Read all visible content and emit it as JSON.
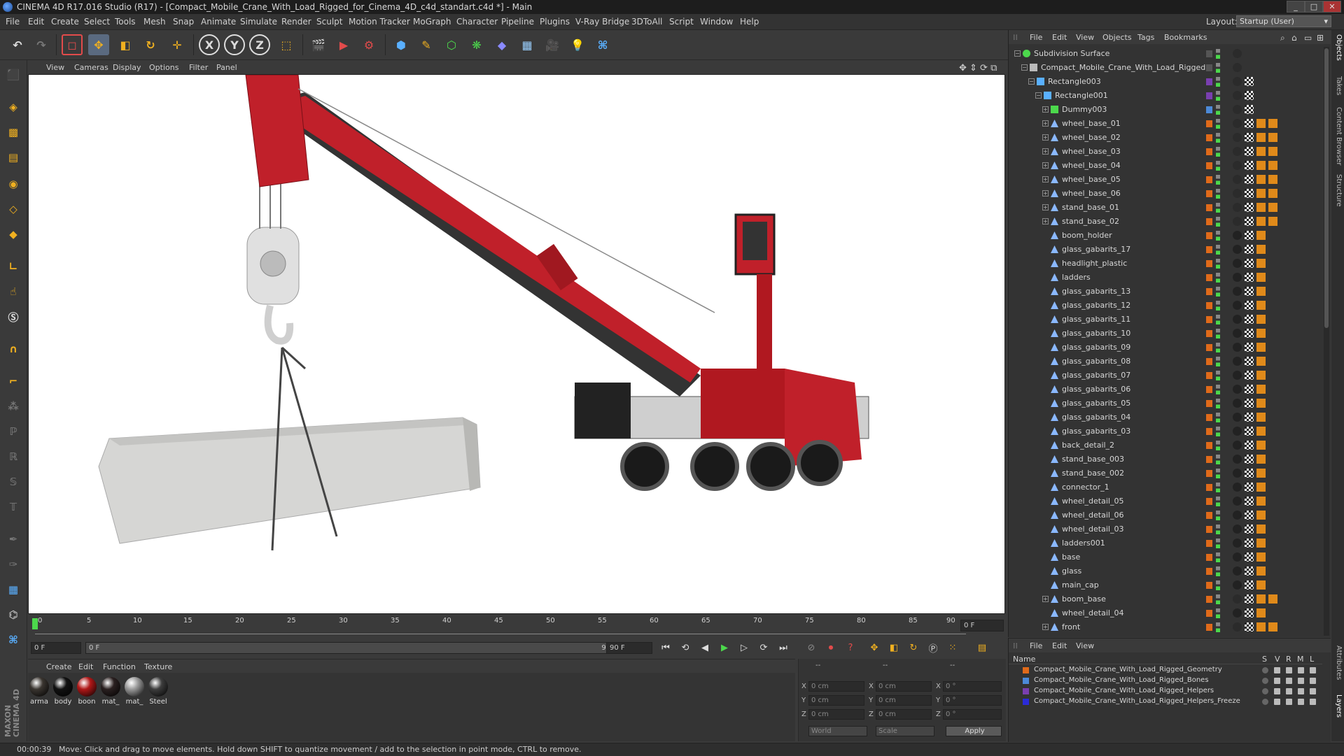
{
  "window": {
    "title": "CINEMA 4D R17.016 Studio (R17) - [Compact_Mobile_Crane_With_Load_Rigged_for_Cinema_4D_c4d_standart.c4d *] - Main",
    "buttons": [
      "_",
      "□",
      "✕"
    ]
  },
  "menubar": {
    "items": [
      "File",
      "Edit",
      "Create",
      "Select",
      "Tools",
      "Mesh",
      "Snap",
      "Animate",
      "Simulate",
      "Render",
      "Sculpt",
      "Motion Tracker",
      "MoGraph",
      "Character",
      "Pipeline",
      "Plugins",
      "V-Ray Bridge",
      "3DToAll",
      "Script",
      "Window",
      "Help"
    ],
    "layout_label": "Layout:",
    "layout_value": "Startup (User)"
  },
  "toolbar": {
    "axis_x": "X",
    "axis_y": "Y",
    "axis_z": "Z"
  },
  "viewport": {
    "menu": [
      "View",
      "Cameras",
      "Display",
      "Options",
      "Filter",
      "Panel"
    ]
  },
  "timeline": {
    "ticks": [
      "0",
      "5",
      "10",
      "15",
      "20",
      "25",
      "30",
      "35",
      "40",
      "45",
      "50",
      "55",
      "60",
      "65",
      "70",
      "75",
      "80",
      "85",
      "90"
    ],
    "current_frame_field": "0 F",
    "start_field": "0 F",
    "range_start": "0 F",
    "range_end": "90 F",
    "end_field": "90 F"
  },
  "material_manager": {
    "menu": [
      "Create",
      "Edit",
      "Function",
      "Texture"
    ],
    "materials": [
      {
        "name": "arma",
        "color": "#3a3530"
      },
      {
        "name": "body",
        "color": "#111111"
      },
      {
        "name": "boon",
        "color": "#b01818"
      },
      {
        "name": "mat_",
        "color": "#2a2020"
      },
      {
        "name": "mat_",
        "color": "#9a9a9a"
      },
      {
        "name": "Steel",
        "color": "#3d3d3d"
      }
    ]
  },
  "coordinates": {
    "headers": [
      "--",
      "--",
      "--"
    ],
    "rows": [
      {
        "axis": "X",
        "pos": "0 cm",
        "size": "0 cm",
        "rot_label": "X",
        "rot": "0 °"
      },
      {
        "axis": "Y",
        "pos": "0 cm",
        "size": "0 cm",
        "rot_label": "Y",
        "rot": "0 °"
      },
      {
        "axis": "Z",
        "pos": "0 cm",
        "size": "0 cm",
        "rot_label": "Z",
        "rot": "0 °"
      }
    ],
    "size_labels": [
      "X",
      "Y",
      "Z"
    ],
    "world": "World",
    "scale": "Scale",
    "apply": "Apply"
  },
  "status": {
    "time": "00:00:39",
    "message": "Move: Click and drag to move elements. Hold down SHIFT to quantize movement / add to the selection in point mode, CTRL to remove."
  },
  "object_manager": {
    "menu": [
      "File",
      "Edit",
      "View",
      "Objects",
      "Tags",
      "Bookmarks"
    ],
    "objects": [
      {
        "name": "Subdivision Surface",
        "indent": 0,
        "icon": "subdivision",
        "layer": "",
        "expand": "−"
      },
      {
        "name": "Compact_Mobile_Crane_With_Load_Rigged",
        "indent": 1,
        "icon": "null",
        "layer": "",
        "expand": "−"
      },
      {
        "name": "Rectangle003",
        "indent": 2,
        "icon": "spline",
        "layer": "#7a3fb0",
        "expand": "−"
      },
      {
        "name": "Rectangle001",
        "indent": 3,
        "icon": "spline",
        "layer": "#7a3fb0",
        "expand": "−"
      },
      {
        "name": "Dummy003",
        "indent": 4,
        "icon": "bone",
        "layer": "#4c8ad8",
        "expand": "+"
      },
      {
        "name": "wheel_base_01",
        "indent": 4,
        "icon": "poly",
        "layer": "#e06a1a",
        "expand": "+"
      },
      {
        "name": "wheel_base_02",
        "indent": 4,
        "icon": "poly",
        "layer": "#e06a1a",
        "expand": "+"
      },
      {
        "name": "wheel_base_03",
        "indent": 4,
        "icon": "poly",
        "layer": "#e06a1a",
        "expand": "+"
      },
      {
        "name": "wheel_base_04",
        "indent": 4,
        "icon": "poly",
        "layer": "#e06a1a",
        "expand": "+"
      },
      {
        "name": "wheel_base_05",
        "indent": 4,
        "icon": "poly",
        "layer": "#e06a1a",
        "expand": "+"
      },
      {
        "name": "wheel_base_06",
        "indent": 4,
        "icon": "poly",
        "layer": "#e06a1a",
        "expand": "+"
      },
      {
        "name": "stand_base_01",
        "indent": 4,
        "icon": "poly",
        "layer": "#e06a1a",
        "expand": "+"
      },
      {
        "name": "stand_base_02",
        "indent": 4,
        "icon": "poly",
        "layer": "#e06a1a",
        "expand": "+"
      },
      {
        "name": "boom_holder",
        "indent": 4,
        "icon": "poly",
        "layer": "#e06a1a",
        "expand": ""
      },
      {
        "name": "glass_gabarits_17",
        "indent": 4,
        "icon": "poly",
        "layer": "#e06a1a",
        "expand": ""
      },
      {
        "name": "headlight_plastic",
        "indent": 4,
        "icon": "poly",
        "layer": "#e06a1a",
        "expand": ""
      },
      {
        "name": "ladders",
        "indent": 4,
        "icon": "poly",
        "layer": "#e06a1a",
        "expand": ""
      },
      {
        "name": "glass_gabarits_13",
        "indent": 4,
        "icon": "poly",
        "layer": "#e06a1a",
        "expand": ""
      },
      {
        "name": "glass_gabarits_12",
        "indent": 4,
        "icon": "poly",
        "layer": "#e06a1a",
        "expand": ""
      },
      {
        "name": "glass_gabarits_11",
        "indent": 4,
        "icon": "poly",
        "layer": "#e06a1a",
        "expand": ""
      },
      {
        "name": "glass_gabarits_10",
        "indent": 4,
        "icon": "poly",
        "layer": "#e06a1a",
        "expand": ""
      },
      {
        "name": "glass_gabarits_09",
        "indent": 4,
        "icon": "poly",
        "layer": "#e06a1a",
        "expand": ""
      },
      {
        "name": "glass_gabarits_08",
        "indent": 4,
        "icon": "poly",
        "layer": "#e06a1a",
        "expand": ""
      },
      {
        "name": "glass_gabarits_07",
        "indent": 4,
        "icon": "poly",
        "layer": "#e06a1a",
        "expand": ""
      },
      {
        "name": "glass_gabarits_06",
        "indent": 4,
        "icon": "poly",
        "layer": "#e06a1a",
        "expand": ""
      },
      {
        "name": "glass_gabarits_05",
        "indent": 4,
        "icon": "poly",
        "layer": "#e06a1a",
        "expand": ""
      },
      {
        "name": "glass_gabarits_04",
        "indent": 4,
        "icon": "poly",
        "layer": "#e06a1a",
        "expand": ""
      },
      {
        "name": "glass_gabarits_03",
        "indent": 4,
        "icon": "poly",
        "layer": "#e06a1a",
        "expand": ""
      },
      {
        "name": "back_detail_2",
        "indent": 4,
        "icon": "poly",
        "layer": "#e06a1a",
        "expand": ""
      },
      {
        "name": "stand_base_003",
        "indent": 4,
        "icon": "poly",
        "layer": "#e06a1a",
        "expand": ""
      },
      {
        "name": "stand_base_002",
        "indent": 4,
        "icon": "poly",
        "layer": "#e06a1a",
        "expand": ""
      },
      {
        "name": "connector_1",
        "indent": 4,
        "icon": "poly",
        "layer": "#e06a1a",
        "expand": ""
      },
      {
        "name": "wheel_detail_05",
        "indent": 4,
        "icon": "poly",
        "layer": "#e06a1a",
        "expand": ""
      },
      {
        "name": "wheel_detail_06",
        "indent": 4,
        "icon": "poly",
        "layer": "#e06a1a",
        "expand": ""
      },
      {
        "name": "wheel_detail_03",
        "indent": 4,
        "icon": "poly",
        "layer": "#e06a1a",
        "expand": ""
      },
      {
        "name": "ladders001",
        "indent": 4,
        "icon": "poly",
        "layer": "#e06a1a",
        "expand": ""
      },
      {
        "name": "base",
        "indent": 4,
        "icon": "poly",
        "layer": "#e06a1a",
        "expand": ""
      },
      {
        "name": "glass",
        "indent": 4,
        "icon": "poly",
        "layer": "#e06a1a",
        "expand": ""
      },
      {
        "name": "main_cap",
        "indent": 4,
        "icon": "poly",
        "layer": "#e06a1a",
        "expand": ""
      },
      {
        "name": "boom_base",
        "indent": 4,
        "icon": "poly",
        "layer": "#e06a1a",
        "expand": "+"
      },
      {
        "name": "wheel_detail_04",
        "indent": 4,
        "icon": "poly",
        "layer": "#e06a1a",
        "expand": ""
      },
      {
        "name": "front",
        "indent": 4,
        "icon": "poly",
        "layer": "#e06a1a",
        "expand": "+"
      }
    ]
  },
  "layer_manager": {
    "menu": [
      "File",
      "Edit",
      "View"
    ],
    "columns": [
      "Name",
      "S",
      "V",
      "R",
      "M",
      "L"
    ],
    "layers": [
      {
        "name": "Compact_Mobile_Crane_With_Load_Rigged_Geometry",
        "color": "#e06a1a"
      },
      {
        "name": "Compact_Mobile_Crane_With_Load_Rigged_Bones",
        "color": "#4c8ad8"
      },
      {
        "name": "Compact_Mobile_Crane_With_Load_Rigged_Helpers",
        "color": "#7a3fb0"
      },
      {
        "name": "Compact_Mobile_Crane_With_Load_Rigged_Helpers_Freeze",
        "color": "#2b2bd8"
      }
    ]
  },
  "right_tabs": [
    "Objects",
    "Takes",
    "Content Browser",
    "Structure",
    "Attributes",
    "Layers"
  ],
  "branding": "MAXON CINEMA 4D"
}
